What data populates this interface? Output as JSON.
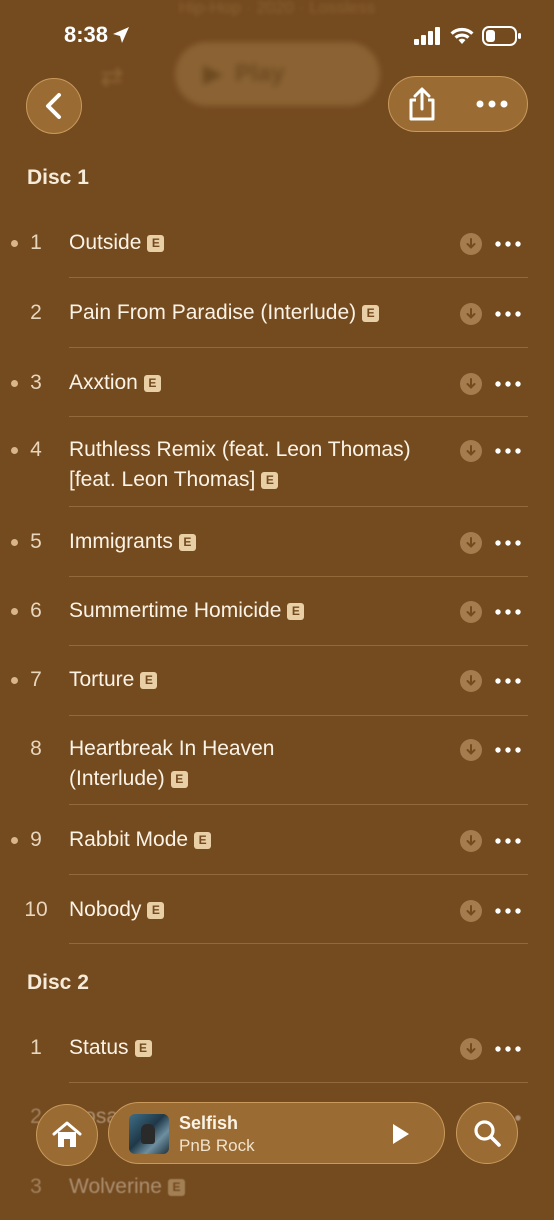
{
  "status_bar": {
    "time": "8:38"
  },
  "header": {
    "subtitle": "Hip-Hop · 2020 · Lossless",
    "play_label": "Play"
  },
  "discs": [
    {
      "label": "Disc 1",
      "tracks": [
        {
          "number": "1",
          "title": "Outside",
          "explicit": "E",
          "downloaded": true
        },
        {
          "number": "2",
          "title": "Pain From Paradise (Interlude)",
          "explicit": "E",
          "downloaded": false
        },
        {
          "number": "3",
          "title": "Axxtion",
          "explicit": "E",
          "downloaded": true
        },
        {
          "number": "4",
          "title": "Ruthless Remix (feat. Leon Thomas) [feat. Leon Thomas]",
          "explicit": "E",
          "downloaded": true
        },
        {
          "number": "5",
          "title": "Immigrants",
          "explicit": "E",
          "downloaded": true
        },
        {
          "number": "6",
          "title": "Summertime Homicide",
          "explicit": "E",
          "downloaded": true
        },
        {
          "number": "7",
          "title": "Torture",
          "explicit": "E",
          "downloaded": true
        },
        {
          "number": "8",
          "title": "Heartbreak In Heaven (Interlude)",
          "explicit": "E",
          "downloaded": false
        },
        {
          "number": "9",
          "title": "Rabbit Mode",
          "explicit": "E",
          "downloaded": true
        },
        {
          "number": "10",
          "title": "Nobody",
          "explicit": "E",
          "downloaded": false
        }
      ]
    },
    {
      "label": "Disc 2",
      "tracks": [
        {
          "number": "1",
          "title": "Status",
          "explicit": "E",
          "downloaded": false
        },
        {
          "number": "2",
          "title": "Cosa Forever",
          "explicit": "E",
          "downloaded": false
        },
        {
          "number": "3",
          "title": "Wolverine",
          "explicit": "E",
          "downloaded": false
        }
      ]
    }
  ],
  "mini_player": {
    "song": "Selfish",
    "artist": "PnB Rock"
  },
  "colors": {
    "background": "#744a1f",
    "button_fill": "#9a6c33",
    "text": "#fbf3e6",
    "badge": "#e9cfa5"
  }
}
